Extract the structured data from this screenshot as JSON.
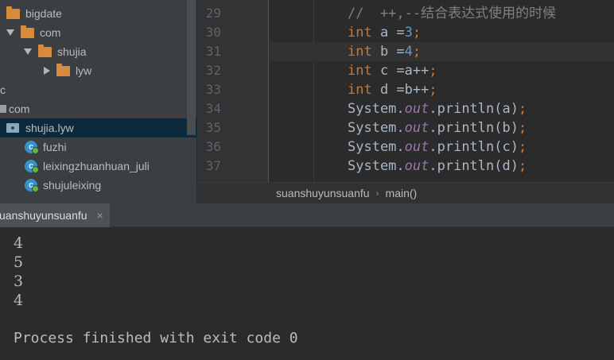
{
  "project_tree": {
    "items": [
      {
        "label": "bigdate",
        "arrow": "none",
        "icon": "folder"
      },
      {
        "label": "com",
        "arrow": "down",
        "icon": "folder"
      },
      {
        "label": "shujia",
        "arrow": "down",
        "icon": "folder"
      },
      {
        "label": "lyw",
        "arrow": "right",
        "icon": "folder"
      },
      {
        "label": "c",
        "arrow": "none",
        "icon": "none"
      },
      {
        "label": "com",
        "arrow": "none",
        "icon": "square"
      },
      {
        "label": "shujia.lyw",
        "arrow": "none",
        "icon": "package"
      },
      {
        "label": "fuzhi",
        "arrow": "none",
        "icon": "class"
      },
      {
        "label": "leixingzhuanhuan_juli",
        "arrow": "none",
        "icon": "class"
      },
      {
        "label": "shujuleixing",
        "arrow": "none",
        "icon": "class"
      }
    ]
  },
  "editor": {
    "line_numbers": [
      "29",
      "30",
      "31",
      "32",
      "33",
      "34",
      "35",
      "36",
      "37"
    ],
    "lines": [
      {
        "kind": "comment",
        "text": "//  ++,--结合表达式使用的时候"
      },
      {
        "kind": "decl",
        "kw": "int",
        "rest": " a =",
        "num": "3",
        "end": ";"
      },
      {
        "kind": "decl",
        "kw": "int",
        "rest": " b =",
        "num": "4",
        "end": ";"
      },
      {
        "kind": "decl",
        "kw": "int",
        "rest": " c =a++",
        "num": "",
        "end": ";"
      },
      {
        "kind": "decl",
        "kw": "int",
        "rest": " d =b++",
        "num": "",
        "end": ";"
      },
      {
        "kind": "print",
        "pre": "System.",
        "field": "out",
        "post": ".println(a)",
        "end": ";"
      },
      {
        "kind": "print",
        "pre": "System.",
        "field": "out",
        "post": ".println(b)",
        "end": ";"
      },
      {
        "kind": "print",
        "pre": "System.",
        "field": "out",
        "post": ".println(c)",
        "end": ";"
      },
      {
        "kind": "print",
        "pre": "System.",
        "field": "out",
        "post": ".println(d)",
        "end": ";"
      }
    ],
    "current_line": 2
  },
  "breadcrumb": {
    "class_name": "suanshuyunsuanfu",
    "separator": "›",
    "method": "main()"
  },
  "run_panel": {
    "tab_label": "suanshuyunsuanfu",
    "close_glyph": "×"
  },
  "console": {
    "lines": [
      "4",
      "5",
      "3",
      "4"
    ],
    "finished": "Process finished with exit code 0"
  },
  "colors": {
    "keyword": "#cc7832",
    "number": "#6897bb",
    "field": "#9876aa",
    "comment": "#808080",
    "folder": "#d88a3d",
    "class_icon": "#3592c4"
  }
}
